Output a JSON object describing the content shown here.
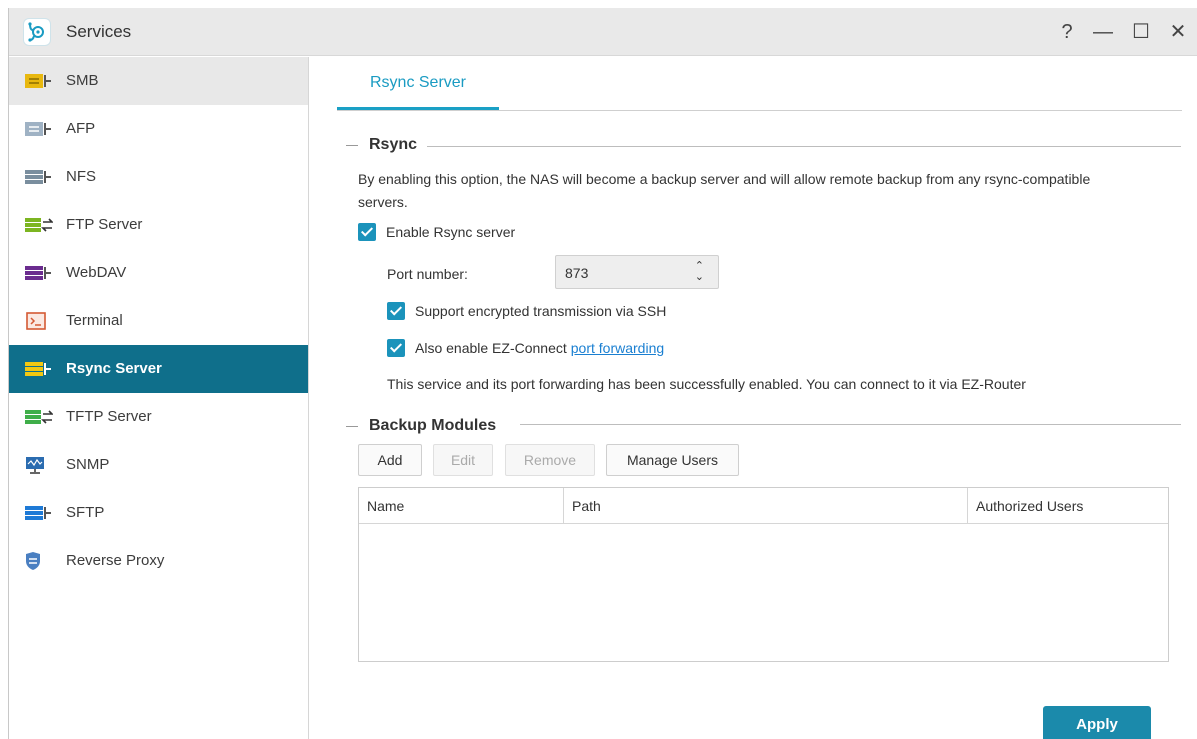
{
  "window": {
    "title": "Services",
    "controls": {
      "help": "?",
      "minimize": "—",
      "maximize": "☐",
      "close": "✕"
    }
  },
  "sidebar": {
    "items": [
      {
        "label": "SMB",
        "icon": "smb-icon",
        "color": "#e8b80f"
      },
      {
        "label": "AFP",
        "icon": "afp-icon",
        "color": "#8fa4b8"
      },
      {
        "label": "NFS",
        "icon": "nfs-icon",
        "color": "#7a8e9e"
      },
      {
        "label": "FTP Server",
        "icon": "ftp-icon",
        "color": "#7cb521"
      },
      {
        "label": "WebDAV",
        "icon": "webdav-icon",
        "color": "#6b2c8f"
      },
      {
        "label": "Terminal",
        "icon": "terminal-icon",
        "color": "#d45a34"
      },
      {
        "label": "Rsync Server",
        "icon": "rsync-icon",
        "color": "#f2c811"
      },
      {
        "label": "TFTP Server",
        "icon": "tftp-icon",
        "color": "#3fae49"
      },
      {
        "label": "SNMP",
        "icon": "snmp-icon",
        "color": "#2b6cb0"
      },
      {
        "label": "SFTP",
        "icon": "sftp-icon",
        "color": "#1e7ad6"
      },
      {
        "label": "Reverse Proxy",
        "icon": "shield-icon",
        "color": "#4a7fc1"
      }
    ],
    "hover_index": 0,
    "active_index": 6
  },
  "main": {
    "tab": "Rsync Server",
    "rsync": {
      "heading": "Rsync",
      "description": "By enabling this option, the NAS will become a backup server and will allow remote backup from any rsync-compatible servers.",
      "enable_label": "Enable Rsync server",
      "port_label": "Port number:",
      "port_value": "873",
      "ssh_label": "Support encrypted transmission via SSH",
      "ezconnect_label": "Also enable EZ-Connect",
      "ezconnect_link": "port forwarding",
      "status": "This service and its port forwarding has been successfully enabled. You can connect to it via EZ-Router"
    },
    "backup": {
      "heading": "Backup Modules",
      "buttons": {
        "add": "Add",
        "edit": "Edit",
        "remove": "Remove",
        "manage": "Manage Users"
      },
      "columns": [
        "Name",
        "Path",
        "Authorized Users"
      ]
    },
    "apply_label": "Apply"
  },
  "colors": {
    "accent": "#1aa0c5",
    "active_sidebar": "#0f6f8b",
    "checkbox": "#1b93bb",
    "apply": "#1b8aab",
    "link": "#1a7fd1"
  }
}
